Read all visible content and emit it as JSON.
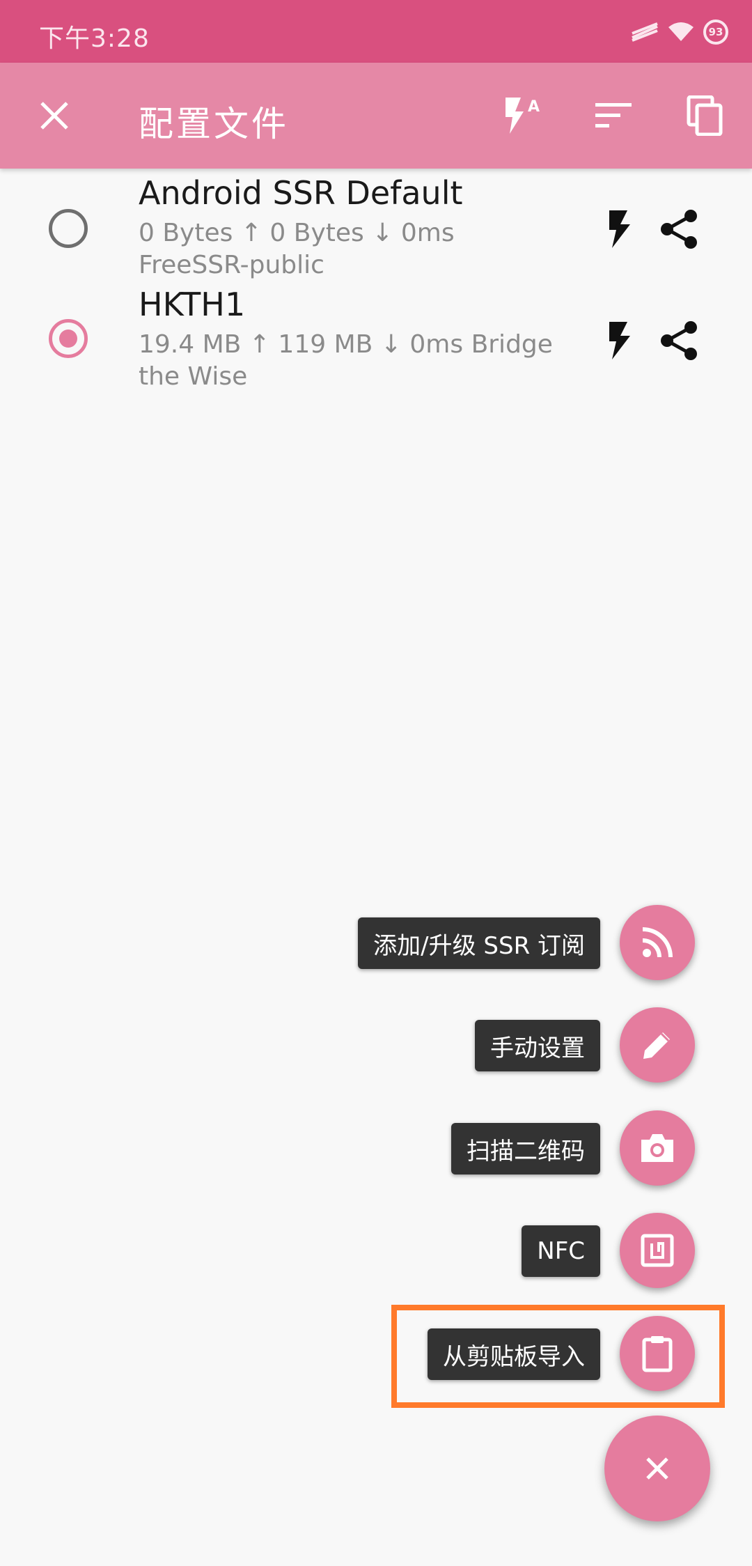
{
  "status_bar": {
    "time": "下午3:28",
    "battery": "93"
  },
  "toolbar": {
    "title": "配置文件"
  },
  "profiles": [
    {
      "name": "Android SSR Default",
      "traffic": "0 Bytes ↑  0 Bytes ↓  0ms",
      "group": "FreeSSR-public",
      "selected": false
    },
    {
      "name": "HKTH1",
      "traffic": "19.4 MB ↑  119 MB ↓  0ms",
      "group": "Bridge the Wise",
      "selected": true
    }
  ],
  "fab_menu": [
    {
      "label": "添加/升级 SSR 订阅",
      "icon": "rss-icon"
    },
    {
      "label": "手动设置",
      "icon": "pencil-icon"
    },
    {
      "label": "扫描二维码",
      "icon": "camera-icon"
    },
    {
      "label": "NFC",
      "icon": "nfc-icon"
    },
    {
      "label": "从剪贴板导入",
      "icon": "clipboard-icon"
    }
  ],
  "colors": {
    "status_bar": "#d9507f",
    "toolbar": "#e588a6",
    "accent": "#e57c9e",
    "highlight": "#ff7a2b"
  }
}
